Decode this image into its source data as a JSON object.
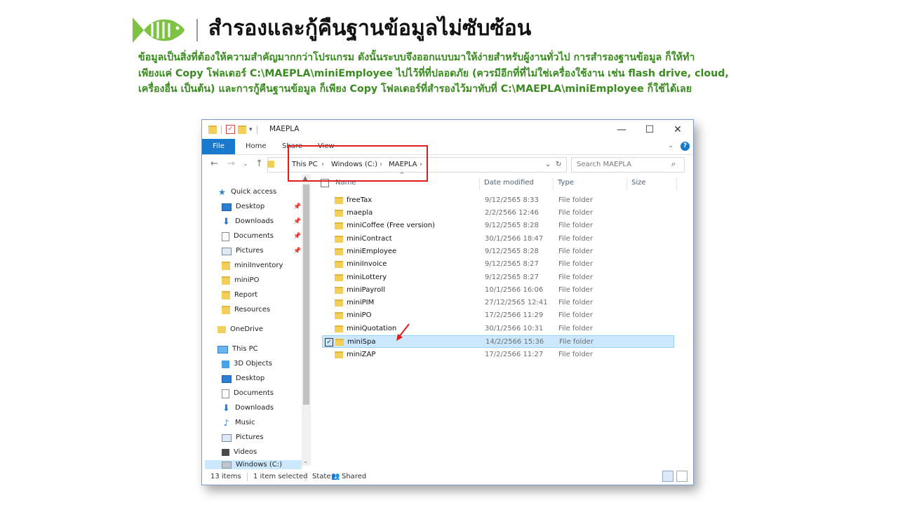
{
  "slide": {
    "title": "สำรองและกู้คืนฐานข้อมูลไม่ซับซ้อน",
    "description": [
      "ข้อมูลเป็นสิ่งที่ต้องให้ความสำคัญมากกว่าโปรแกรม ดังนั้นระบบจึงออกแบบมาให้ง่ายสำหรับผู้งานทั่วไป การสำรองฐานข้อมูล ก็ให้ทำ",
      "เพียงแค่ Copy โฟลเดอร์ C:\\MAEPLA\\miniEmployee ไปไว้ที่ที่ปลอดภัย (ควรมีอีกที่ที่ไม่ใช่เครื่องใช้งาน เช่น flash drive, cloud,",
      "เครื่องอื่น เป็นต้น) และการกู้คืนฐานข้อมูล ก็เพียง Copy โฟลเดอร์ที่สำรองไว้มาทับที่ C:\\MAEPLA\\miniEmployee ก็ใช้ได้เลย"
    ],
    "accent_color": "#3a8b1f"
  },
  "window": {
    "title": "MAEPLA",
    "controls": {
      "minimize": "—",
      "maximize": "☐",
      "close": "✕"
    },
    "ribbon_tabs": [
      "File",
      "Home",
      "Share",
      "View"
    ],
    "breadcrumb": [
      "This PC",
      "Windows (C:)",
      "MAEPLA"
    ],
    "breadcrumb_sep": "›",
    "search_placeholder": "Search MAEPLA",
    "columns": {
      "name": "Name",
      "date": "Date modified",
      "type": "Type",
      "size": "Size"
    },
    "nav": {
      "quick_access": "Quick access",
      "quick_items": [
        "Desktop",
        "Downloads",
        "Documents",
        "Pictures",
        "miniInventory",
        "miniPO",
        "Report",
        "Resources"
      ],
      "onedrive": "OneDrive",
      "this_pc": "This PC",
      "pc_items": [
        "3D Objects",
        "Desktop",
        "Documents",
        "Downloads",
        "Music",
        "Pictures",
        "Videos",
        "Windows (C:)"
      ]
    },
    "files": [
      {
        "name": "freeTax",
        "date": "9/12/2565 8:33",
        "type": "File folder"
      },
      {
        "name": "maepla",
        "date": "2/2/2566 12:46",
        "type": "File folder"
      },
      {
        "name": "miniCoffee (Free version)",
        "date": "9/12/2565 8:28",
        "type": "File folder"
      },
      {
        "name": "miniContract",
        "date": "30/1/2566 18:47",
        "type": "File folder"
      },
      {
        "name": "miniEmployee",
        "date": "9/12/2565 8:28",
        "type": "File folder"
      },
      {
        "name": "miniInvoice",
        "date": "9/12/2565 8:27",
        "type": "File folder"
      },
      {
        "name": "miniLottery",
        "date": "9/12/2565 8:27",
        "type": "File folder"
      },
      {
        "name": "miniPayroll",
        "date": "10/1/2566 16:06",
        "type": "File folder"
      },
      {
        "name": "miniPIM",
        "date": "27/12/2565 12:41",
        "type": "File folder"
      },
      {
        "name": "miniPO",
        "date": "17/2/2566 11:29",
        "type": "File folder"
      },
      {
        "name": "miniQuotation",
        "date": "30/1/2566 10:31",
        "type": "File folder"
      },
      {
        "name": "miniSpa",
        "date": "14/2/2566 15:36",
        "type": "File folder",
        "selected": true
      },
      {
        "name": "miniZAP",
        "date": "17/2/2566 11:27",
        "type": "File folder"
      }
    ],
    "status": {
      "items": "13 items",
      "selected": "1 item selected",
      "state": "State:",
      "shared": "Shared"
    }
  }
}
